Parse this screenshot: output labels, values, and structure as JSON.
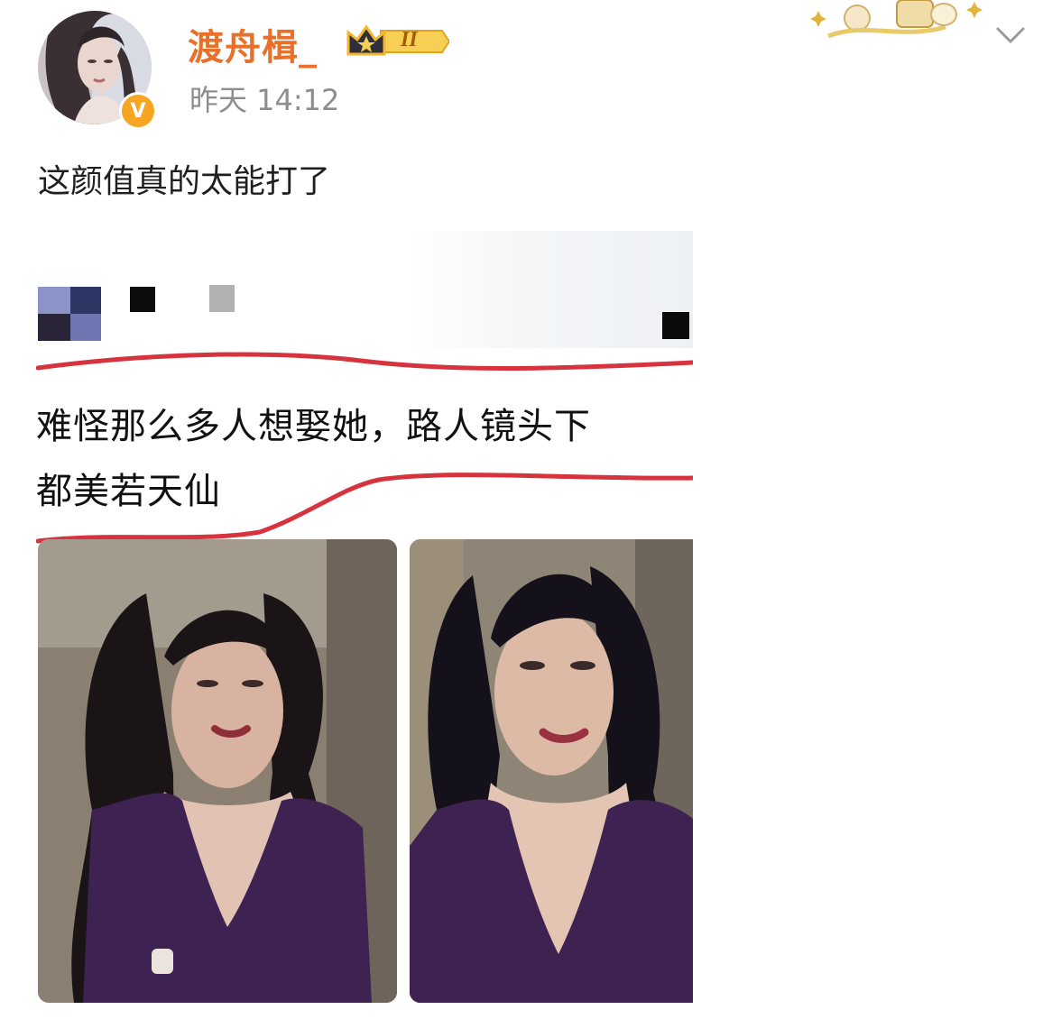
{
  "post": {
    "username": "渡舟楫_",
    "level_badge": "II",
    "timestamp": "昨天 14:12",
    "verified_badge": "V",
    "text": "这颜值真的太能打了"
  },
  "repost_image": {
    "caption_line1": "难怪那么多人想娶她，路人镜头下",
    "caption_line2": "都美若天仙"
  },
  "icons": {
    "avatar": "avatar-illustrated-woman",
    "verified": "verified-v-icon",
    "level": "crown-level-badge-icon",
    "menu": "chevron-down-icon"
  },
  "colors": {
    "username": "#e8702a",
    "timestamp": "#8d8d8d",
    "underline": "#d6333f",
    "dress": "#3e2352"
  }
}
